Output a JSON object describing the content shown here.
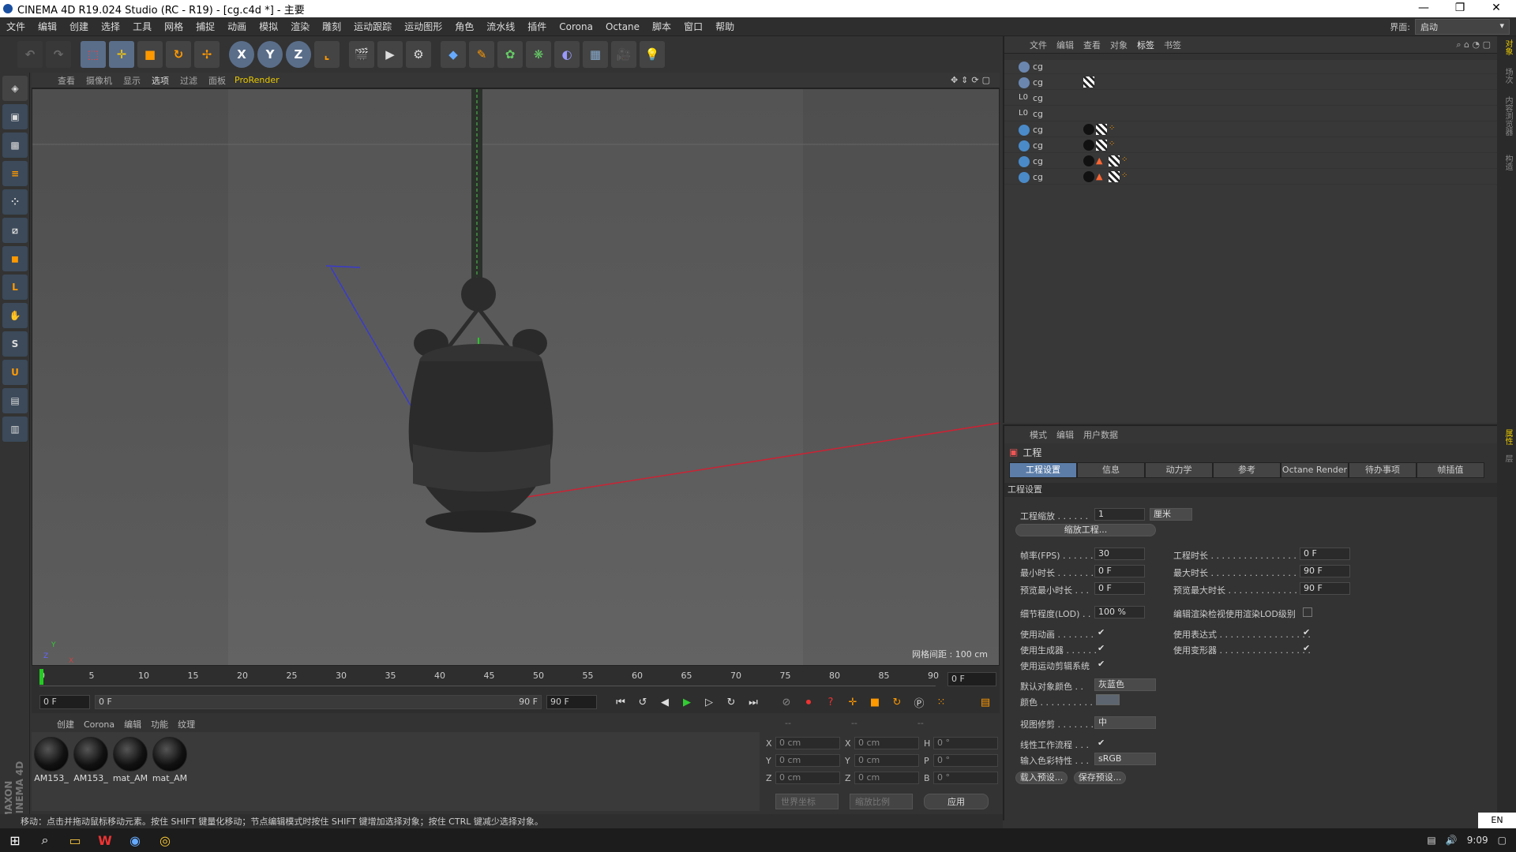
{
  "window": {
    "title": "CINEMA 4D R19.024 Studio (RC - R19) - [cg.c4d *] - 主要",
    "minimize": "—",
    "maximize": "❐",
    "close": "✕"
  },
  "menu": [
    "文件",
    "编辑",
    "创建",
    "选择",
    "工具",
    "网格",
    "捕捉",
    "动画",
    "模拟",
    "渲染",
    "雕刻",
    "运动跟踪",
    "运动图形",
    "角色",
    "流水线",
    "插件",
    "Corona",
    "Octane",
    "脚本",
    "窗口",
    "帮助"
  ],
  "layout": {
    "label": "界面:",
    "value": "启动"
  },
  "viewport_menu": [
    "查看",
    "摄像机",
    "显示",
    "选项",
    "过滤",
    "面板"
  ],
  "viewport_renderer": "ProRender",
  "viewport_grid": "网格间距 : 100 cm",
  "timeline": {
    "ticks": [
      "0",
      "5",
      "10",
      "15",
      "20",
      "25",
      "30",
      "35",
      "40",
      "45",
      "50",
      "55",
      "60",
      "65",
      "70",
      "75",
      "80",
      "85",
      "90"
    ],
    "current": "0 F"
  },
  "timeline_ctl": {
    "start": "0 F",
    "range_start": "0 F",
    "range_end": "90 F",
    "end": "90 F"
  },
  "material_menu": [
    "创建",
    "Corona",
    "编辑",
    "功能",
    "纹理"
  ],
  "materials": [
    "AM153_",
    "AM153_",
    "mat_AM",
    "mat_AM"
  ],
  "coords": {
    "headers": [
      "--",
      "--",
      "--"
    ],
    "x": "0 cm",
    "y": "0 cm",
    "z": "0 cm",
    "sx": "0 cm",
    "sy": "0 cm",
    "sz": "0 cm",
    "h": "0 °",
    "p": "0 °",
    "b": "0 °",
    "mode1": "世界坐标",
    "mode2": "缩放比例",
    "apply": "应用"
  },
  "status": "移动：点击并拖动鼠标移动元素。按住 SHIFT 键量化移动；节点编辑模式时按住 SHIFT 键增加选择对象；按住 CTRL 键减少选择对象。",
  "object_menu": [
    "文件",
    "编辑",
    "查看",
    "对象",
    "标签",
    "书签"
  ],
  "objects": [
    "cg",
    "cg",
    "cg",
    "cg",
    "cg",
    "cg",
    "cg",
    "cg"
  ],
  "attr_menu": [
    "模式",
    "编辑",
    "用户数据"
  ],
  "attr_title": "工程",
  "attr_tabs": [
    "工程设置",
    "信息",
    "动力学",
    "参考",
    "Octane Render",
    "待办事项",
    "帧插值"
  ],
  "attr_section": "工程设置",
  "project": {
    "scale_label": "工程缩放 . . . . . .",
    "scale_value": "1",
    "scale_unit": "厘米",
    "scale_btn": "缩放工程...",
    "fps_label": "帧率(FPS) . . . . . .",
    "fps": "30",
    "time_label": "工程时长 . . . . . . . . . . . . . . . . . .",
    "time": "0 F",
    "min_label": "最小时长 . . . . . . .",
    "min": "0 F",
    "max_label": "最大时长 . . . . . . . . . . . . . . . . . .",
    "max": "90 F",
    "pmin_label": "预览最小时长 . . .",
    "pmin": "0 F",
    "pmax_label": "预览最大时长 . . . . . . . . . . . . . . .",
    "pmax": "90 F",
    "lod_label": "细节程度(LOD) . .",
    "lod": "100 %",
    "lod_render_label": "编辑渲染检视使用渲染LOD级别",
    "anim_label": "使用动画 . . . . . . .",
    "expr_label": "使用表达式 . . . . . . . . . . . . . . . . .",
    "gen_label": "使用生成器 . . . . . .",
    "deform_label": "使用变形器 . . . . . . . . . . . . . . . . .",
    "mograph_label": "使用运动剪辑系统",
    "objcolor_label": "默认对象颜色 . .",
    "objcolor": "灰蓝色",
    "color_label": "颜色 . . . . . . . . . .",
    "clip_label": "视图修剪 . . . . . . .",
    "clip": "中",
    "linear_label": "线性工作流程 . . .",
    "profile_label": "输入色彩特性 . . .",
    "profile": "sRGB",
    "load_btn": "载入预设...",
    "save_btn": "保存预设..."
  },
  "side_tabs": [
    "对象",
    "场次",
    "内容浏览器",
    "构造"
  ],
  "side_tabs2": [
    "属性",
    "层"
  ],
  "taskbar": {
    "lang": "EN",
    "time": "9:09"
  },
  "logo": "MAXON CINEMA 4D"
}
